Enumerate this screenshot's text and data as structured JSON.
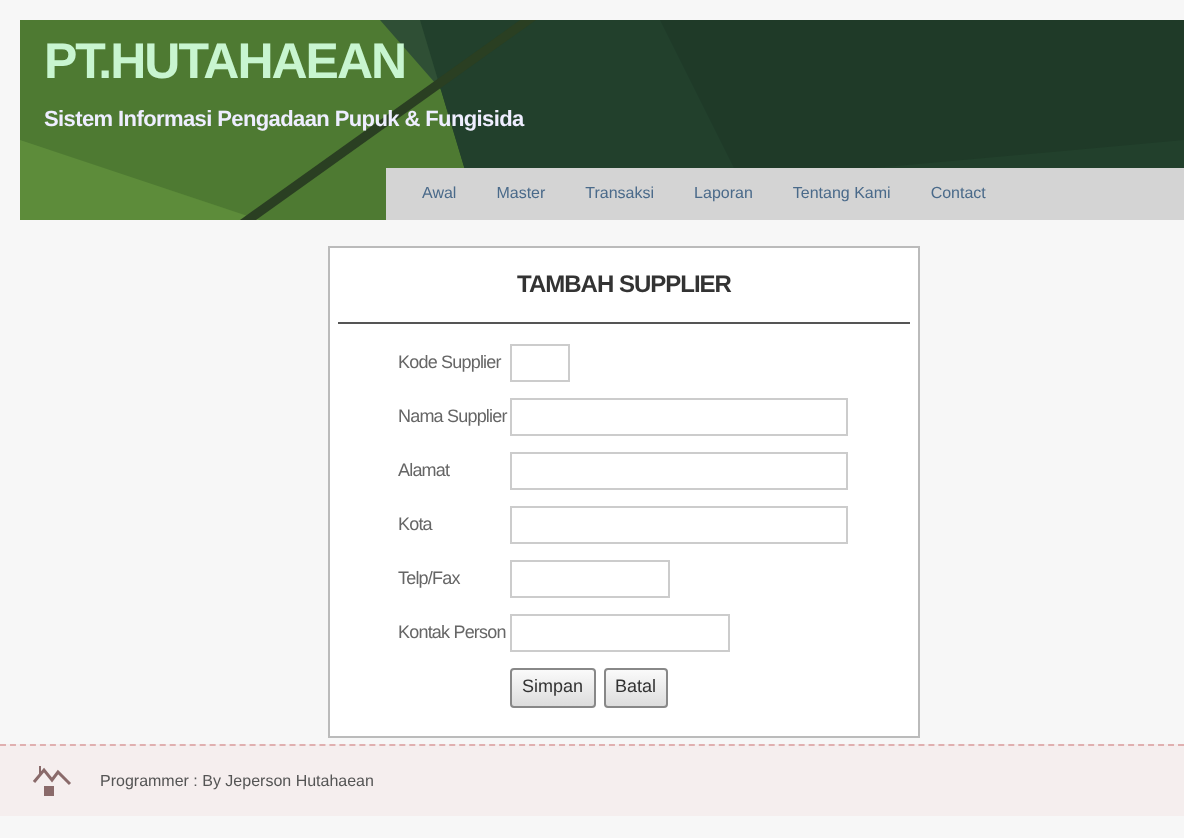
{
  "header": {
    "title": "PT.HUTAHAEAN",
    "subtitle": "Sistem Informasi Pengadaan Pupuk & Fungisida"
  },
  "nav": [
    "Awal",
    "Master",
    "Transaksi",
    "Laporan",
    "Tentang Kami",
    "Contact"
  ],
  "form": {
    "title": "TAMBAH SUPPLIER",
    "fields": [
      {
        "label": "Kode Supplier"
      },
      {
        "label": "Nama Supplier"
      },
      {
        "label": "Alamat"
      },
      {
        "label": "Kota"
      },
      {
        "label": "Telp/Fax"
      },
      {
        "label": "Kontak Person"
      }
    ],
    "buttons": [
      "Simpan",
      "Batal"
    ]
  },
  "footer": {
    "text": "Programmer : By Jeperson Hutahaean"
  }
}
